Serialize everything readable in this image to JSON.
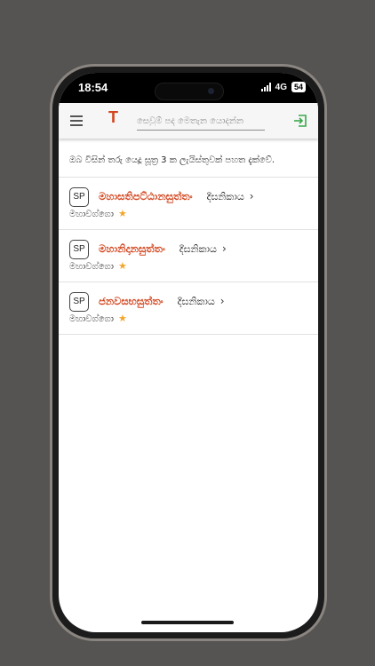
{
  "status_bar": {
    "time": "18:54",
    "network": "4G",
    "battery": "54"
  },
  "app_bar": {
    "brand_glyph": "T",
    "brand_color": "#d2451e",
    "search_placeholder": "සෙවුම් පද මෙතැන යොදන්න",
    "menu_icon": "hamburger-menu-icon",
    "login_icon": "login-icon",
    "login_icon_color": "#3aa84a"
  },
  "intro_text": "ඔබ විසින් තරු යෙදූ සූත්‍ර 3 ක ලැයිස්තුවක් පහත දැක්වේ.",
  "results": [
    {
      "badge": "SP",
      "title": "මහාසතිපට්ඨානසුත්තං",
      "collection": "දීඝනිකාය",
      "section": "මහාවග්ගො"
    },
    {
      "badge": "SP",
      "title": "මහානිදානසුත්තං",
      "collection": "දීඝනිකාය",
      "section": "මහාවග්ගො"
    },
    {
      "badge": "SP",
      "title": "ජනවසභසුත්තං",
      "collection": "දීඝනිකාය",
      "section": "මහාවග්ගො"
    }
  ],
  "colors": {
    "accent": "#d2451e",
    "star": "#f4a52a",
    "background": "#555452"
  }
}
